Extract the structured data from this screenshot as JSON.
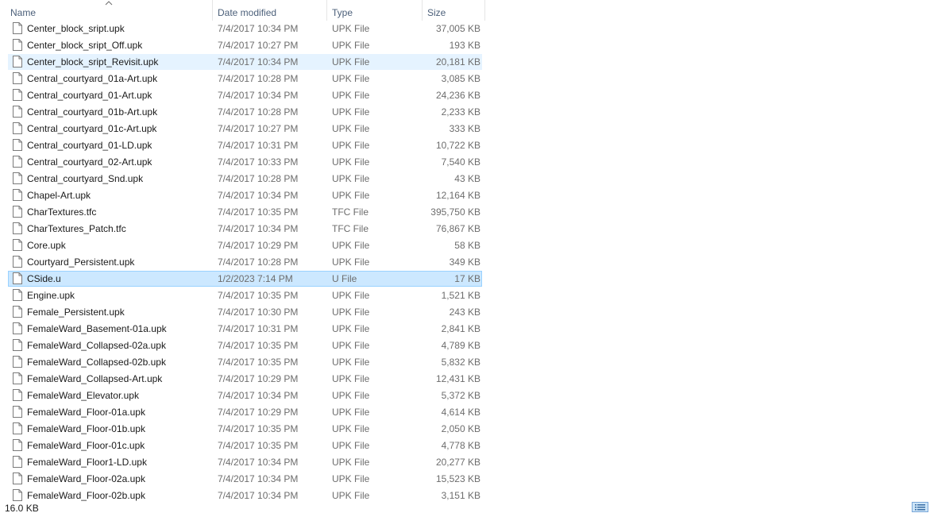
{
  "columns": {
    "name": "Name",
    "date_modified": "Date modified",
    "type": "Type",
    "size": "Size"
  },
  "sort": {
    "column": "name",
    "direction": "ascending",
    "icon": "sort-up-caret-icon"
  },
  "files": [
    {
      "name": "Center_block_sript.upk",
      "date": "7/4/2017 10:34 PM",
      "type": "UPK File",
      "size": "37,005 KB",
      "state": "normal"
    },
    {
      "name": "Center_block_sript_Off.upk",
      "date": "7/4/2017 10:27 PM",
      "type": "UPK File",
      "size": "193 KB",
      "state": "normal"
    },
    {
      "name": "Center_block_sript_Revisit.upk",
      "date": "7/4/2017 10:34 PM",
      "type": "UPK File",
      "size": "20,181 KB",
      "state": "hover"
    },
    {
      "name": "Central_courtyard_01a-Art.upk",
      "date": "7/4/2017 10:28 PM",
      "type": "UPK File",
      "size": "3,085 KB",
      "state": "normal"
    },
    {
      "name": "Central_courtyard_01-Art.upk",
      "date": "7/4/2017 10:34 PM",
      "type": "UPK File",
      "size": "24,236 KB",
      "state": "normal"
    },
    {
      "name": "Central_courtyard_01b-Art.upk",
      "date": "7/4/2017 10:28 PM",
      "type": "UPK File",
      "size": "2,233 KB",
      "state": "normal"
    },
    {
      "name": "Central_courtyard_01c-Art.upk",
      "date": "7/4/2017 10:27 PM",
      "type": "UPK File",
      "size": "333 KB",
      "state": "normal"
    },
    {
      "name": "Central_courtyard_01-LD.upk",
      "date": "7/4/2017 10:31 PM",
      "type": "UPK File",
      "size": "10,722 KB",
      "state": "normal"
    },
    {
      "name": "Central_courtyard_02-Art.upk",
      "date": "7/4/2017 10:33 PM",
      "type": "UPK File",
      "size": "7,540 KB",
      "state": "normal"
    },
    {
      "name": "Central_courtyard_Snd.upk",
      "date": "7/4/2017 10:28 PM",
      "type": "UPK File",
      "size": "43 KB",
      "state": "normal"
    },
    {
      "name": "Chapel-Art.upk",
      "date": "7/4/2017 10:34 PM",
      "type": "UPK File",
      "size": "12,164 KB",
      "state": "normal"
    },
    {
      "name": "CharTextures.tfc",
      "date": "7/4/2017 10:35 PM",
      "type": "TFC File",
      "size": "395,750 KB",
      "state": "normal"
    },
    {
      "name": "CharTextures_Patch.tfc",
      "date": "7/4/2017 10:34 PM",
      "type": "TFC File",
      "size": "76,867 KB",
      "state": "normal"
    },
    {
      "name": "Core.upk",
      "date": "7/4/2017 10:29 PM",
      "type": "UPK File",
      "size": "58 KB",
      "state": "normal"
    },
    {
      "name": "Courtyard_Persistent.upk",
      "date": "7/4/2017 10:28 PM",
      "type": "UPK File",
      "size": "349 KB",
      "state": "normal"
    },
    {
      "name": "CSide.u",
      "date": "1/2/2023 7:14 PM",
      "type": "U File",
      "size": "17 KB",
      "state": "selected"
    },
    {
      "name": "Engine.upk",
      "date": "7/4/2017 10:35 PM",
      "type": "UPK File",
      "size": "1,521 KB",
      "state": "normal"
    },
    {
      "name": "Female_Persistent.upk",
      "date": "7/4/2017 10:30 PM",
      "type": "UPK File",
      "size": "243 KB",
      "state": "normal"
    },
    {
      "name": "FemaleWard_Basement-01a.upk",
      "date": "7/4/2017 10:31 PM",
      "type": "UPK File",
      "size": "2,841 KB",
      "state": "normal"
    },
    {
      "name": "FemaleWard_Collapsed-02a.upk",
      "date": "7/4/2017 10:35 PM",
      "type": "UPK File",
      "size": "4,789 KB",
      "state": "normal"
    },
    {
      "name": "FemaleWard_Collapsed-02b.upk",
      "date": "7/4/2017 10:35 PM",
      "type": "UPK File",
      "size": "5,832 KB",
      "state": "normal"
    },
    {
      "name": "FemaleWard_Collapsed-Art.upk",
      "date": "7/4/2017 10:29 PM",
      "type": "UPK File",
      "size": "12,431 KB",
      "state": "normal"
    },
    {
      "name": "FemaleWard_Elevator.upk",
      "date": "7/4/2017 10:34 PM",
      "type": "UPK File",
      "size": "5,372 KB",
      "state": "normal"
    },
    {
      "name": "FemaleWard_Floor-01a.upk",
      "date": "7/4/2017 10:29 PM",
      "type": "UPK File",
      "size": "4,614 KB",
      "state": "normal"
    },
    {
      "name": "FemaleWard_Floor-01b.upk",
      "date": "7/4/2017 10:35 PM",
      "type": "UPK File",
      "size": "2,050 KB",
      "state": "normal"
    },
    {
      "name": "FemaleWard_Floor-01c.upk",
      "date": "7/4/2017 10:35 PM",
      "type": "UPK File",
      "size": "4,778 KB",
      "state": "normal"
    },
    {
      "name": "FemaleWard_Floor1-LD.upk",
      "date": "7/4/2017 10:34 PM",
      "type": "UPK File",
      "size": "20,277 KB",
      "state": "normal"
    },
    {
      "name": "FemaleWard_Floor-02a.upk",
      "date": "7/4/2017 10:34 PM",
      "type": "UPK File",
      "size": "15,523 KB",
      "state": "normal"
    },
    {
      "name": "FemaleWard_Floor-02b.upk",
      "date": "7/4/2017 10:34 PM",
      "type": "UPK File",
      "size": "3,151 KB",
      "state": "normal"
    }
  ],
  "file_icon": "generic-file-icon",
  "statusbar": {
    "selection_size": "16.0 KB",
    "view_icon": "details-view-icon"
  },
  "colors": {
    "header_text": "#4c607a",
    "hover_bg": "#e5f3ff",
    "selected_bg": "#cce8ff",
    "selected_border": "#99d1ff",
    "secondary_text": "#6d6d6d"
  }
}
